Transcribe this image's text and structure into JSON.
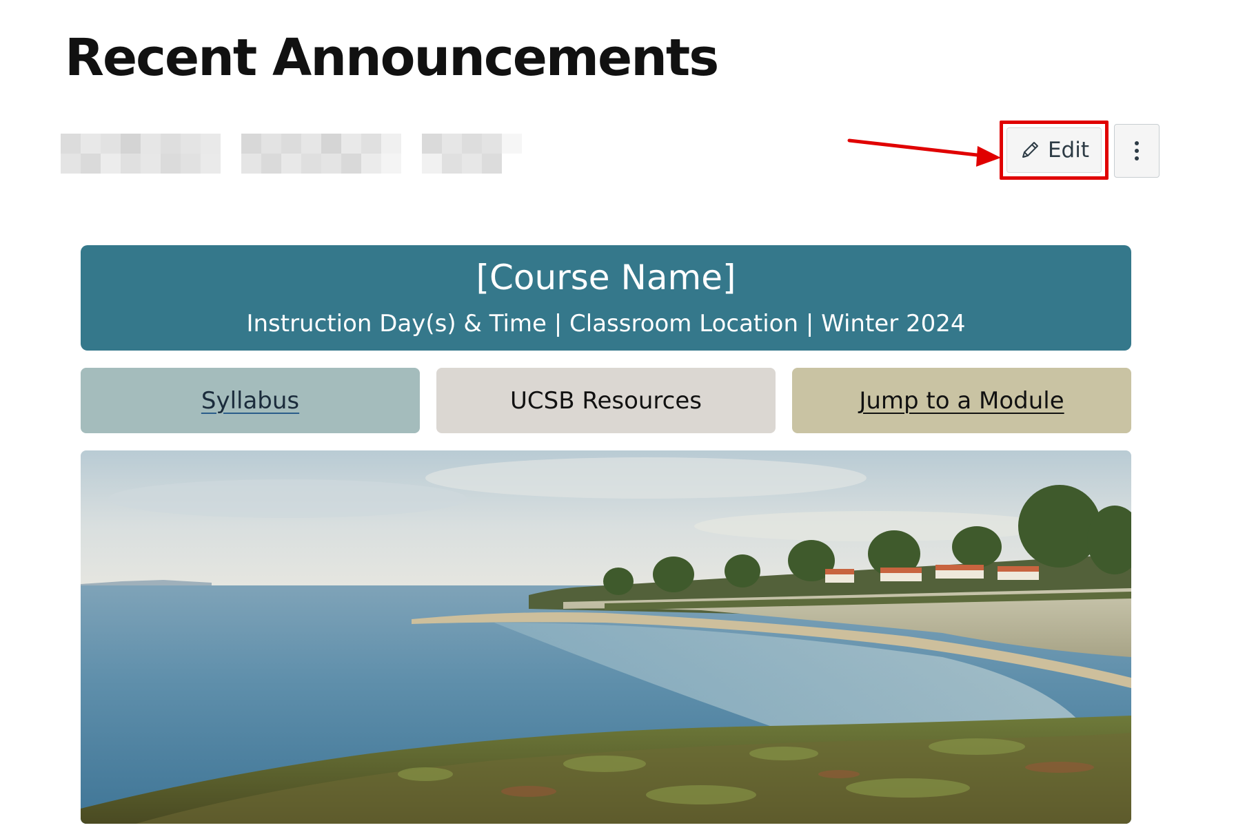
{
  "header": {
    "title": "Recent Announcements"
  },
  "toolbar": {
    "edit_label": "Edit",
    "edit_icon": "pencil-icon",
    "more_icon": "kebab-menu-icon"
  },
  "annotation": {
    "arrow_color": "#e00000",
    "highlight_color": "#e00000"
  },
  "banner": {
    "course_name": "[Course Name]",
    "details": "Instruction Day(s) & Time | Classroom Location | Winter 2024",
    "background": "#35788b"
  },
  "nav_tiles": [
    {
      "label": "Syllabus",
      "background": "#a4bcbc",
      "is_link": true
    },
    {
      "label": "UCSB Resources",
      "background": "#dbd7d2",
      "is_link": false
    },
    {
      "label": "Jump to a Module",
      "background": "#c9c3a3",
      "is_link": true
    }
  ]
}
